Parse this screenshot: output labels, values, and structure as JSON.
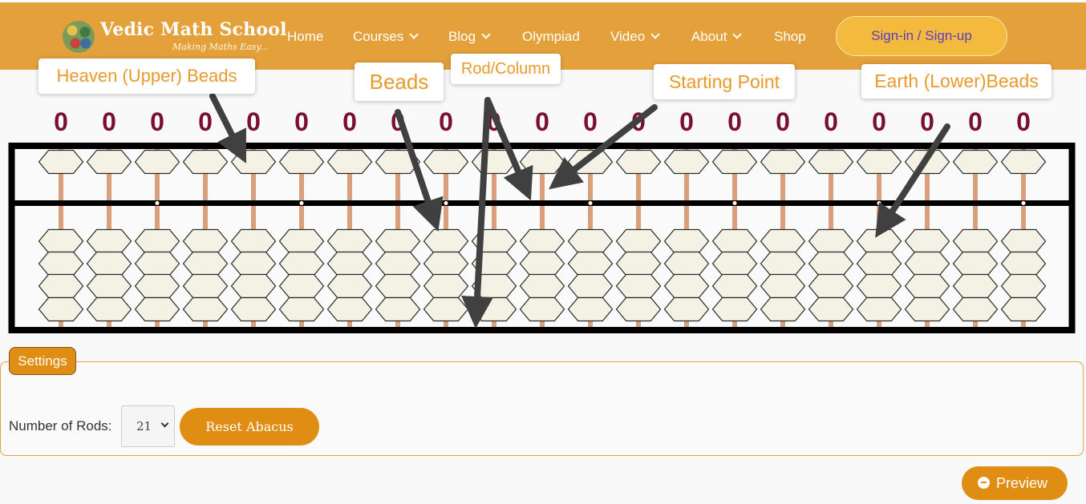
{
  "header": {
    "logo_title": "Vedic Math School",
    "logo_tagline": "Making Maths Easy...",
    "nav": [
      {
        "label": "Home",
        "dropdown": false
      },
      {
        "label": "Courses",
        "dropdown": true
      },
      {
        "label": "Blog",
        "dropdown": true
      },
      {
        "label": "Olympiad",
        "dropdown": false
      },
      {
        "label": "Video",
        "dropdown": true
      },
      {
        "label": "About",
        "dropdown": true
      },
      {
        "label": "Shop",
        "dropdown": false
      }
    ],
    "signin_label": "Sign-in / Sign-up"
  },
  "callouts": {
    "heaven": "Heaven (Upper) Beads",
    "beads": "Beads",
    "rod": "Rod/Column",
    "start": "Starting Point",
    "earth": "Earth (Lower)Beads"
  },
  "abacus": {
    "rod_count": 21,
    "digits": [
      "0",
      "0",
      "0",
      "0",
      "0",
      "0",
      "0",
      "0",
      "0",
      "0",
      "0",
      "0",
      "0",
      "0",
      "0",
      "0",
      "0",
      "0",
      "0",
      "0",
      "0"
    ],
    "unit_dot_rods": [
      2,
      5,
      8,
      11,
      14,
      17,
      20
    ]
  },
  "settings": {
    "legend": "Settings",
    "rods_label": "Number of Rods:",
    "rods_value": "21",
    "reset_label": "Reset Abacus"
  },
  "preview_label": "Preview",
  "colors": {
    "header_bg": "#e4a13b",
    "accent": "#e08d14",
    "signin_bg": "#f4ba3d",
    "signin_text": "#5b3cc4",
    "callout_text": "#e99a2c",
    "digit": "#7a1030",
    "bead_fill": "#f4f2e4",
    "rod": "#d9a07c",
    "frame": "#000000"
  }
}
